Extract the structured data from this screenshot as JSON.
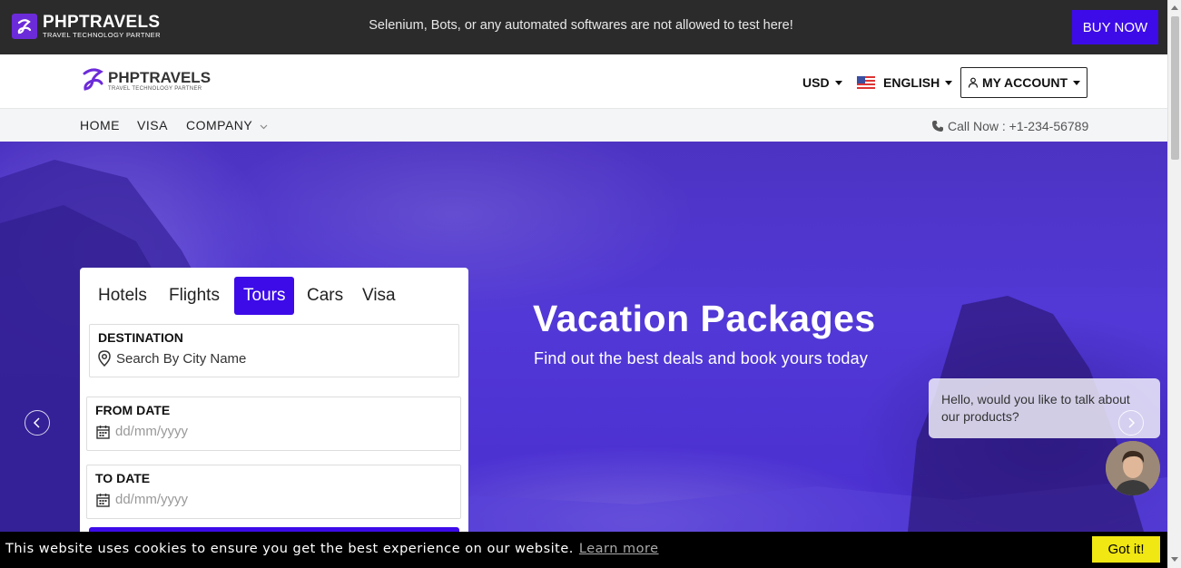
{
  "topbar": {
    "brand": "PHPTRAVELS",
    "tagline": "TRAVEL TECHNOLOGY PARTNER",
    "notice": "Selenium, Bots, or any automated softwares are not allowed to test here!",
    "buy_label": "BUY NOW"
  },
  "header": {
    "brand": "PHPTRAVELS",
    "tagline": "TRAVEL TECHNOLOGY PARTNER",
    "currency": "USD",
    "language": "ENGLISH",
    "account_label": "MY ACCOUNT"
  },
  "nav": {
    "items": [
      {
        "label": "HOME"
      },
      {
        "label": "VISA"
      },
      {
        "label": "COMPANY"
      }
    ],
    "call_text": "Call Now : +1-234-56789"
  },
  "hero": {
    "title": "Vacation Packages",
    "subtitle": "Find out the best deals and book yours today"
  },
  "search": {
    "tabs": [
      {
        "label": "Hotels"
      },
      {
        "label": "Flights"
      },
      {
        "label": "Tours",
        "active": true
      },
      {
        "label": "Cars"
      },
      {
        "label": "Visa"
      }
    ],
    "destination": {
      "label": "DESTINATION",
      "placeholder": "Search By City Name"
    },
    "from_date": {
      "label": "FROM DATE",
      "placeholder": "dd/mm/yyyy"
    },
    "to_date": {
      "label": "TO DATE",
      "placeholder": "dd/mm/yyyy"
    }
  },
  "chat": {
    "message": "Hello, would you like to talk about our products?"
  },
  "cookie": {
    "text": "This website uses cookies to ensure you get the best experience on our website.",
    "link": "Learn more",
    "button": "Got it!"
  },
  "colors": {
    "accent": "#3d0be8",
    "topbar": "#2b2b2b",
    "cookie_button": "#f1e712"
  }
}
